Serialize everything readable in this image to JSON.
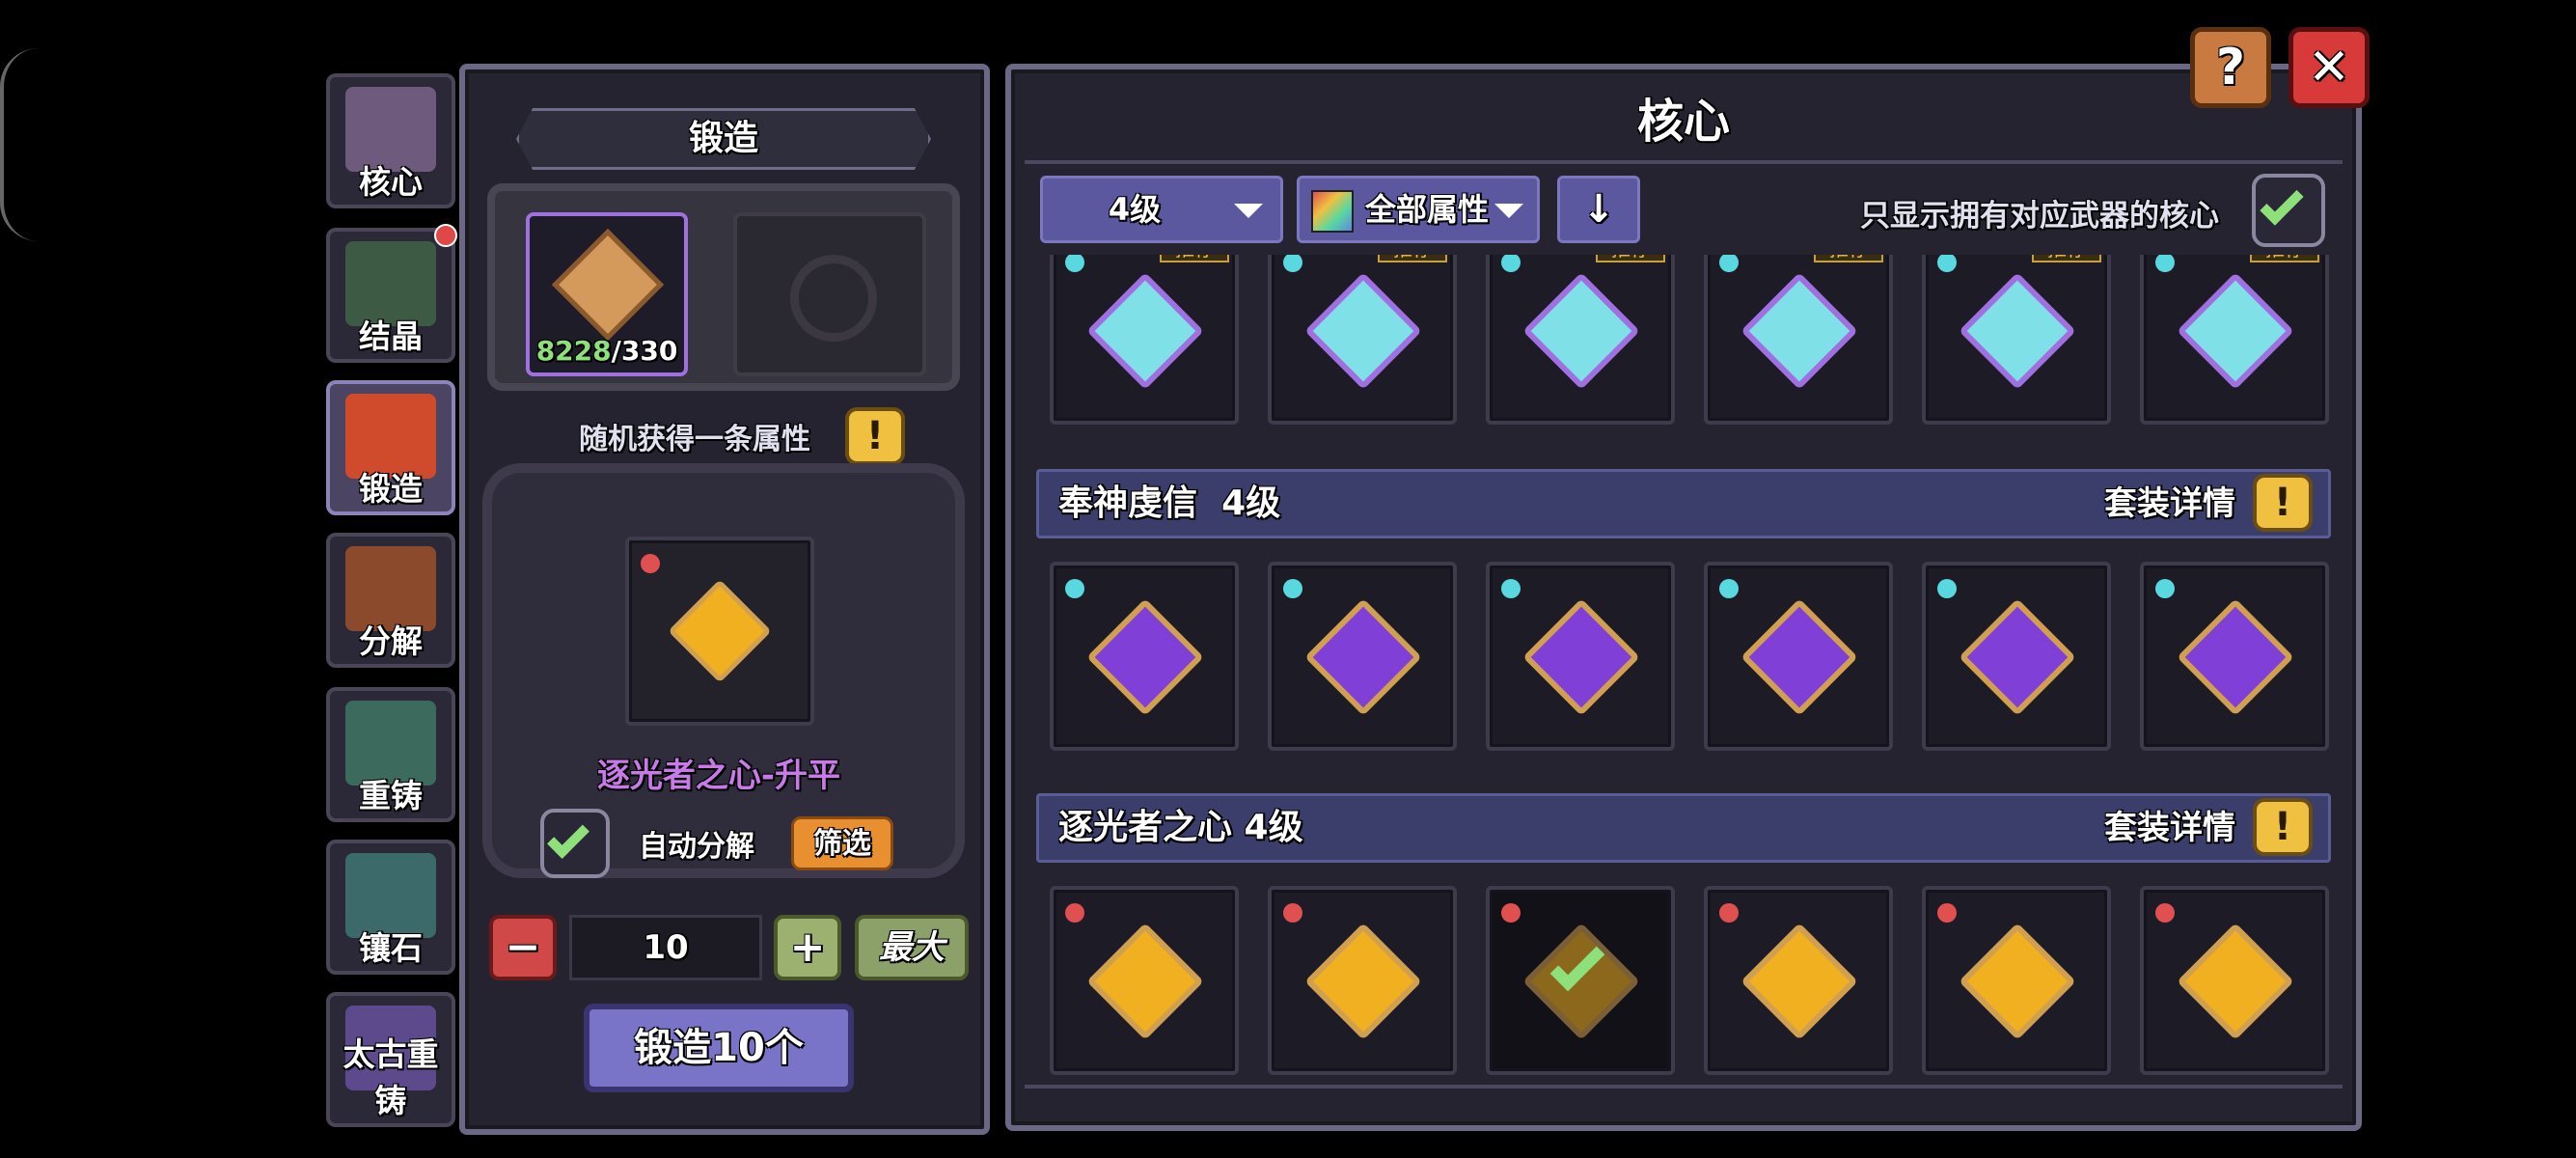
{
  "nav": [
    {
      "label": "核心",
      "color": "#6e5a7c",
      "active": false
    },
    {
      "label": "结晶",
      "color": "#3c5a44",
      "active": false
    },
    {
      "label": "锻造",
      "color": "#d04a2c",
      "active": true
    },
    {
      "label": "分解",
      "color": "#8c4a2c",
      "active": false
    },
    {
      "label": "重铸",
      "color": "#3c6a5c",
      "active": false
    },
    {
      "label": "镶石",
      "color": "#3c6a6a",
      "active": false
    },
    {
      "label": "太古重铸",
      "color": "#5c4a8c",
      "active": false
    }
  ],
  "forge": {
    "title": "锻造",
    "material_have": "8228",
    "material_need": "/330",
    "random_attr_label": "随机获得一条属性",
    "result_name": "逐光者之心-升平",
    "auto_decompose_label": "自动分解",
    "auto_decompose_checked": true,
    "filter_label": "筛选",
    "quantity": "10",
    "max_label": "最大",
    "forge_button": "锻造10个",
    "info_icon": "!"
  },
  "cores": {
    "title": "核心",
    "level_select": "4级",
    "attr_select": "全部属性",
    "filter_toggle_label": "只显示拥有对应武器的核心",
    "filter_toggle_checked": true,
    "recommend_tag": "推存",
    "sets": [
      {
        "name": "",
        "colors": [
          "#7fe0e8",
          "#a070e0"
        ],
        "dot": "#5ad8e0",
        "recommended": true,
        "items": 6
      },
      {
        "name": "奉神虔信  4级",
        "detail": "套装详情",
        "colors": [
          "#8040d8",
          "#d0a050"
        ],
        "dot": "#5ad8e0",
        "recommended": false,
        "items": 6
      },
      {
        "name": "逐光者之心 4级",
        "detail": "套装详情",
        "colors": [
          "#f0b020",
          "#d0a050"
        ],
        "dot": "#e05050",
        "recommended": false,
        "items": 6,
        "checked_index": 2
      }
    ]
  },
  "top_buttons": {
    "help": "?",
    "close": "✕"
  }
}
